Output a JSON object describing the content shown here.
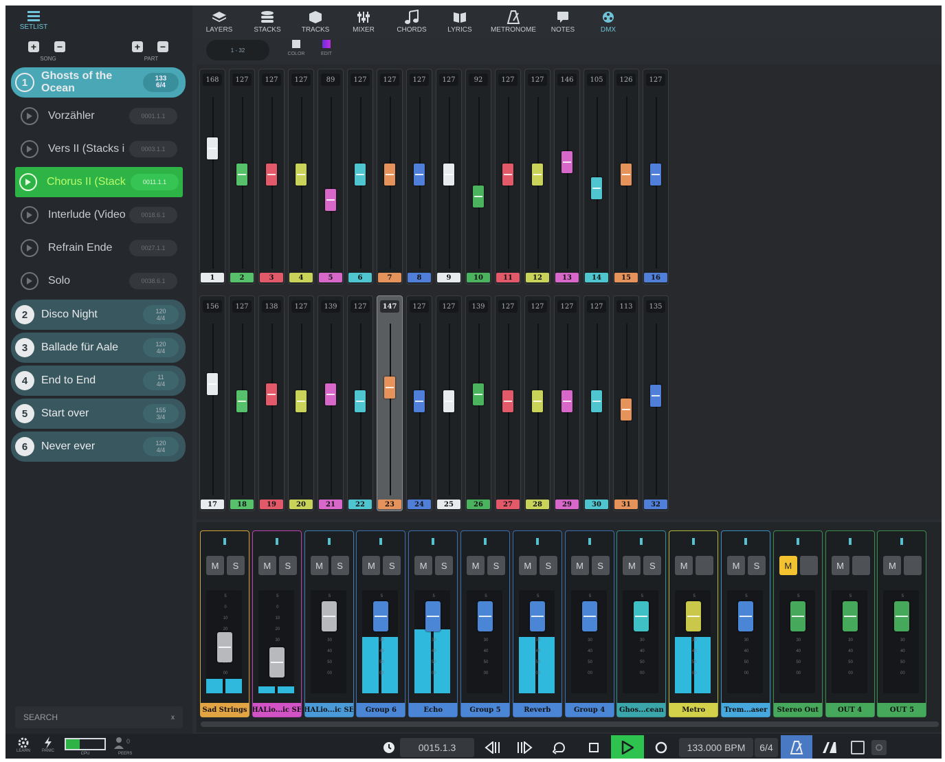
{
  "colors": {
    "accent_teal": "#3fa8b4",
    "active_green": "#2eb347",
    "play_bg": "#2ec24f"
  },
  "nav": [
    {
      "label": "SETLIST",
      "icon": "menu-icon"
    },
    {
      "label": "LAYERS",
      "icon": "layers-icon"
    },
    {
      "label": "STACKS",
      "icon": "stacks-icon"
    },
    {
      "label": "TRACKS",
      "icon": "tracks-icon"
    },
    {
      "label": "MIXER",
      "icon": "mixer-icon"
    },
    {
      "label": "CHORDS",
      "icon": "chords-icon"
    },
    {
      "label": "LYRICS",
      "icon": "lyrics-icon"
    },
    {
      "label": "METRONOME",
      "icon": "metronome-icon"
    },
    {
      "label": "NOTES",
      "icon": "notes-icon"
    },
    {
      "label": "DMX",
      "icon": "dmx-icon"
    }
  ],
  "setlist_toolbar": {
    "song_label": "SONG",
    "part_label": "PART"
  },
  "subtoolbar": {
    "range": "1 - 32",
    "color_label": "COLOR",
    "edit_label": "EDIT"
  },
  "active_song": {
    "number": "1",
    "title": "Ghosts of the Ocean",
    "bpm": "133",
    "sig": "6/4"
  },
  "parts": [
    {
      "title": "Vorzähler",
      "pos": "0001.1.1",
      "active": false
    },
    {
      "title": "Vers II (Stacks i",
      "pos": "0003.1.1",
      "active": false
    },
    {
      "title": "Chorus II (Stack",
      "pos": "0011.1.1",
      "active": true
    },
    {
      "title": "Interlude (Video",
      "pos": "0018.6.1",
      "active": false
    },
    {
      "title": "Refrain Ende",
      "pos": "0027.1.1",
      "active": false
    },
    {
      "title": "Solo",
      "pos": "0038.6.1",
      "active": false
    }
  ],
  "songs": [
    {
      "number": "2",
      "title": "Disco Night",
      "bpm": "120",
      "sig": "4/4"
    },
    {
      "number": "3",
      "title": "Ballade für Aale",
      "bpm": "120",
      "sig": "4/4"
    },
    {
      "number": "4",
      "title": "End to End",
      "bpm": "11",
      "sig": "4/4"
    },
    {
      "number": "5",
      "title": "Start over",
      "bpm": "155",
      "sig": "3/4"
    },
    {
      "number": "6",
      "title": "Never ever",
      "bpm": "120",
      "sig": "4/4"
    }
  ],
  "search": {
    "placeholder": "SEARCH",
    "clear": "x"
  },
  "layers_top": [
    {
      "n": "1",
      "v": "168",
      "color": "#e8ebee",
      "level": 0.7
    },
    {
      "n": "2",
      "v": "127",
      "color": "#57c06b",
      "level": 0.55
    },
    {
      "n": "3",
      "v": "127",
      "color": "#e25a6a",
      "level": 0.55
    },
    {
      "n": "4",
      "v": "127",
      "color": "#c9d35a",
      "level": 0.55
    },
    {
      "n": "5",
      "v": "89",
      "color": "#d767c9",
      "level": 0.4
    },
    {
      "n": "6",
      "v": "127",
      "color": "#4fc6cf",
      "level": 0.55
    },
    {
      "n": "7",
      "v": "127",
      "color": "#e6935b",
      "level": 0.55
    },
    {
      "n": "8",
      "v": "127",
      "color": "#4f7fd8",
      "level": 0.55
    },
    {
      "n": "9",
      "v": "127",
      "color": "#e8ebee",
      "level": 0.55
    },
    {
      "n": "10",
      "v": "92",
      "color": "#4bb35e",
      "level": 0.42
    },
    {
      "n": "11",
      "v": "127",
      "color": "#e25a6a",
      "level": 0.55
    },
    {
      "n": "12",
      "v": "127",
      "color": "#c9d35a",
      "level": 0.55
    },
    {
      "n": "13",
      "v": "146",
      "color": "#d767c9",
      "level": 0.62
    },
    {
      "n": "14",
      "v": "105",
      "color": "#4fc6cf",
      "level": 0.47
    },
    {
      "n": "15",
      "v": "126",
      "color": "#e6935b",
      "level": 0.55
    },
    {
      "n": "16",
      "v": "127",
      "color": "#4f7fd8",
      "level": 0.55
    }
  ],
  "layers_bottom": [
    {
      "n": "17",
      "v": "156",
      "color": "#e8ebee",
      "level": 0.65
    },
    {
      "n": "18",
      "v": "127",
      "color": "#57c06b",
      "level": 0.55
    },
    {
      "n": "19",
      "v": "138",
      "color": "#e25a6a",
      "level": 0.59
    },
    {
      "n": "20",
      "v": "127",
      "color": "#c9d35a",
      "level": 0.55
    },
    {
      "n": "21",
      "v": "139",
      "color": "#d767c9",
      "level": 0.59
    },
    {
      "n": "22",
      "v": "127",
      "color": "#4fc6cf",
      "level": 0.55
    },
    {
      "n": "23",
      "v": "147",
      "color": "#e6935b",
      "level": 0.63,
      "selected": true
    },
    {
      "n": "24",
      "v": "127",
      "color": "#4f7fd8",
      "level": 0.55
    },
    {
      "n": "25",
      "v": "127",
      "color": "#e8ebee",
      "level": 0.55
    },
    {
      "n": "26",
      "v": "139",
      "color": "#4bb35e",
      "level": 0.59
    },
    {
      "n": "27",
      "v": "127",
      "color": "#e25a6a",
      "level": 0.55
    },
    {
      "n": "28",
      "v": "127",
      "color": "#c9d35a",
      "level": 0.55
    },
    {
      "n": "29",
      "v": "127",
      "color": "#d767c9",
      "level": 0.55
    },
    {
      "n": "30",
      "v": "127",
      "color": "#4fc6cf",
      "level": 0.55
    },
    {
      "n": "31",
      "v": "113",
      "color": "#e6935b",
      "level": 0.5
    },
    {
      "n": "32",
      "v": "135",
      "color": "#4f7fd8",
      "level": 0.58
    }
  ],
  "mixer": [
    {
      "name": "Sad Strings",
      "frame": "#d4a536",
      "label_bg": "#e3a444",
      "knob": "#b7b9bc",
      "meter": 0.14,
      "fader": 0.45,
      "m": "M",
      "s": "S"
    },
    {
      "name": "HALio...ic SE",
      "frame": "#c242b8",
      "label_bg": "#d253c6",
      "knob": "#b7b9bc",
      "meter": 0.07,
      "fader": 0.3,
      "m": "M",
      "s": "S"
    },
    {
      "name": "HALio...ic SE",
      "frame": "#3a7fb5",
      "label_bg": "#4a9ad8",
      "knob": "#b7b9bc",
      "meter": 0.0,
      "fader": 0.75,
      "m": "M",
      "s": "S"
    },
    {
      "name": "Group 6",
      "frame": "#3c6fb0",
      "label_bg": "#4a86d5",
      "knob": "#4a86d5",
      "meter": 0.55,
      "fader": 0.75,
      "m": "M",
      "s": "S"
    },
    {
      "name": "Echo",
      "frame": "#3c6fb0",
      "label_bg": "#4a86d5",
      "knob": "#4a86d5",
      "meter": 0.62,
      "fader": 0.75,
      "m": "M",
      "s": "S"
    },
    {
      "name": "Group 5",
      "frame": "#3c6fb0",
      "label_bg": "#4a86d5",
      "knob": "#4a86d5",
      "meter": 0.0,
      "fader": 0.75,
      "m": "M",
      "s": "S"
    },
    {
      "name": "Reverb",
      "frame": "#3c6fb0",
      "label_bg": "#4a86d5",
      "knob": "#4a86d5",
      "meter": 0.55,
      "fader": 0.75,
      "m": "M",
      "s": "S"
    },
    {
      "name": "Group 4",
      "frame": "#3c6fb0",
      "label_bg": "#4a86d5",
      "knob": "#4a86d5",
      "meter": 0.0,
      "fader": 0.75,
      "m": "M",
      "s": "S"
    },
    {
      "name": "Ghos...cean",
      "frame": "#2f8f94",
      "label_bg": "#3aa6ab",
      "knob": "#3fc0c4",
      "meter": 0.0,
      "fader": 0.75,
      "m": "M",
      "s": "S"
    },
    {
      "name": "Metro",
      "frame": "#b5b53a",
      "label_bg": "#d3d04a",
      "knob": "#c9c84a",
      "meter": 0.55,
      "fader": 0.75,
      "m": "M",
      "s": ""
    },
    {
      "name": "Trem...aser",
      "frame": "#3a8fc0",
      "label_bg": "#46a8dc",
      "knob": "#4a86d5",
      "meter": 0.0,
      "fader": 0.75,
      "m": "M",
      "s": "S"
    },
    {
      "name": "Stereo Out",
      "frame": "#3a8f4f",
      "label_bg": "#45a85a",
      "knob": "#45a85a",
      "meter": 0.0,
      "fader": 0.75,
      "m": "M",
      "s": "",
      "muted": true
    },
    {
      "name": "OUT 4",
      "frame": "#3a8f4f",
      "label_bg": "#45a85a",
      "knob": "#45a85a",
      "meter": 0.0,
      "fader": 0.75,
      "m": "M",
      "s": ""
    },
    {
      "name": "OUT 5",
      "frame": "#3a8f4f",
      "label_bg": "#45a85a",
      "knob": "#45a85a",
      "meter": 0.0,
      "fader": 0.75,
      "m": "M",
      "s": ""
    }
  ],
  "fader_scale": [
    "5",
    "0",
    "10",
    "20",
    "30",
    "40",
    "50",
    "00"
  ],
  "bottom": {
    "learn": "LEARN",
    "panic": "PANIC",
    "cpu": "CPU",
    "peers": "PEERS",
    "peers_count": "0",
    "cpu_level": 0.35,
    "position": "0015.1.3",
    "tempo": "133.000 BPM",
    "sig": "6/4"
  }
}
